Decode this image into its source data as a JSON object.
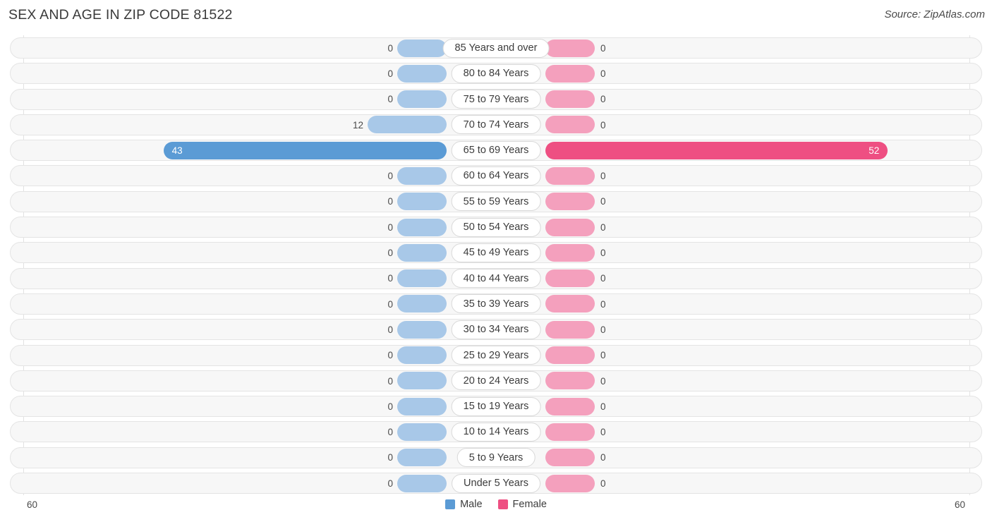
{
  "header": {
    "title": "SEX AND AGE IN ZIP CODE 81522",
    "source": "Source: ZipAtlas.com"
  },
  "legend": {
    "male_label": "Male",
    "female_label": "Female",
    "male_color": "#5b9bd5",
    "female_color": "#ee4f82"
  },
  "axis": {
    "left_label": "60",
    "right_label": "60",
    "max": 60
  },
  "chart_data": {
    "type": "bar",
    "subtype": "population-pyramid",
    "title": "SEX AND AGE IN ZIP CODE 81522",
    "xlabel": "",
    "ylabel": "",
    "xlim": [
      0,
      60
    ],
    "grid": false,
    "legend_position": "bottom-center",
    "categories": [
      "85 Years and over",
      "80 to 84 Years",
      "75 to 79 Years",
      "70 to 74 Years",
      "65 to 69 Years",
      "60 to 64 Years",
      "55 to 59 Years",
      "50 to 54 Years",
      "45 to 49 Years",
      "40 to 44 Years",
      "35 to 39 Years",
      "30 to 34 Years",
      "25 to 29 Years",
      "20 to 24 Years",
      "15 to 19 Years",
      "10 to 14 Years",
      "5 to 9 Years",
      "Under 5 Years"
    ],
    "series": [
      {
        "name": "Male",
        "color": "#5b9bd5",
        "values": [
          0,
          0,
          0,
          12,
          43,
          0,
          0,
          0,
          0,
          0,
          0,
          0,
          0,
          0,
          0,
          0,
          0,
          0
        ]
      },
      {
        "name": "Female",
        "color": "#ee4f82",
        "values": [
          0,
          0,
          0,
          0,
          52,
          0,
          0,
          0,
          0,
          0,
          0,
          0,
          0,
          0,
          0,
          0,
          0,
          0
        ]
      }
    ]
  },
  "rows": [
    {
      "label": "85 Years and over",
      "male": "0",
      "female": "0"
    },
    {
      "label": "80 to 84 Years",
      "male": "0",
      "female": "0"
    },
    {
      "label": "75 to 79 Years",
      "male": "0",
      "female": "0"
    },
    {
      "label": "70 to 74 Years",
      "male": "12",
      "female": "0"
    },
    {
      "label": "65 to 69 Years",
      "male": "43",
      "female": "52"
    },
    {
      "label": "60 to 64 Years",
      "male": "0",
      "female": "0"
    },
    {
      "label": "55 to 59 Years",
      "male": "0",
      "female": "0"
    },
    {
      "label": "50 to 54 Years",
      "male": "0",
      "female": "0"
    },
    {
      "label": "45 to 49 Years",
      "male": "0",
      "female": "0"
    },
    {
      "label": "40 to 44 Years",
      "male": "0",
      "female": "0"
    },
    {
      "label": "35 to 39 Years",
      "male": "0",
      "female": "0"
    },
    {
      "label": "30 to 34 Years",
      "male": "0",
      "female": "0"
    },
    {
      "label": "25 to 29 Years",
      "male": "0",
      "female": "0"
    },
    {
      "label": "20 to 24 Years",
      "male": "0",
      "female": "0"
    },
    {
      "label": "15 to 19 Years",
      "male": "0",
      "female": "0"
    },
    {
      "label": "10 to 14 Years",
      "male": "0",
      "female": "0"
    },
    {
      "label": "5 to 9 Years",
      "male": "0",
      "female": "0"
    },
    {
      "label": "Under 5 Years",
      "male": "0",
      "female": "0"
    }
  ]
}
